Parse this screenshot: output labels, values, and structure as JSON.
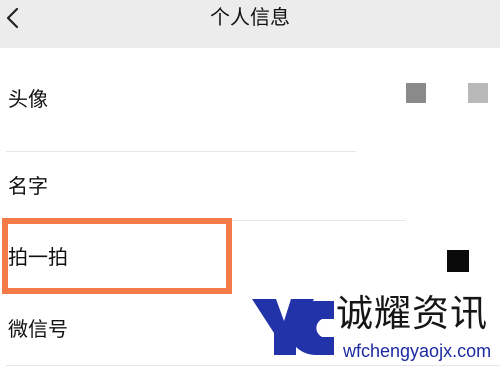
{
  "header": {
    "back_icon": "chevron-left-icon",
    "title": "个人信息"
  },
  "rows": [
    {
      "label": "头像"
    },
    {
      "label": "名字"
    },
    {
      "label": "拍一拍"
    },
    {
      "label": "微信号"
    }
  ],
  "watermark": {
    "brand": "诚耀资讯",
    "url": "wfchengyaojx.com",
    "logo_color": "#2233aa"
  },
  "colors": {
    "highlight": "#f47b47",
    "header_bg": "#ececec"
  }
}
